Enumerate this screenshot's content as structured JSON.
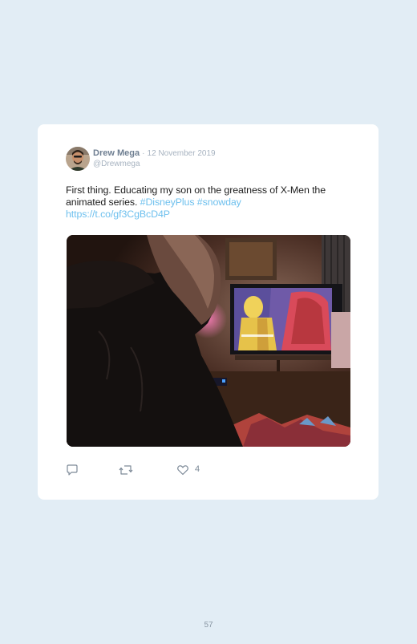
{
  "tweet": {
    "author_name": "Drew Mega",
    "separator": "·",
    "date": "12 November 2019",
    "handle": "@Drewmega",
    "text_main": "First thing. Educating my son on the greatness of X-Men the animated series. ",
    "hashtag_1": "#DisneyPlus",
    "hashtag_2": "#snowday",
    "link": "https://t.co/gf3CgBcD4P",
    "like_count": "4"
  },
  "icons": {
    "reply": "reply-icon",
    "retweet": "retweet-icon",
    "like": "heart-icon"
  },
  "colors": {
    "page_background": "#e2edf5",
    "card_background": "#ffffff",
    "link": "#6ec0ee",
    "author": "#6f7f92"
  },
  "page": {
    "number": "57"
  }
}
